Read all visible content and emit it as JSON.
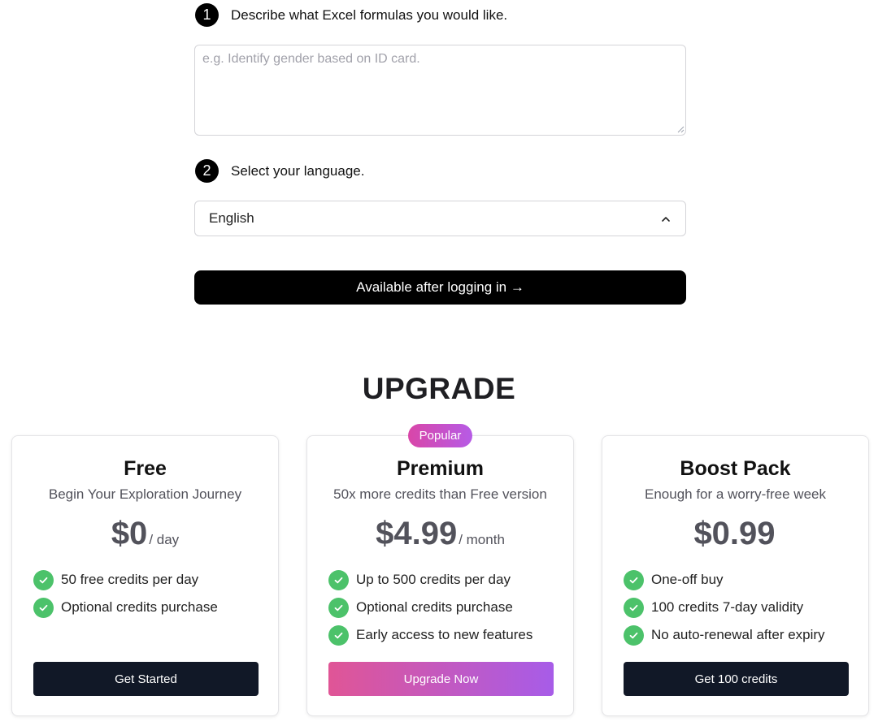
{
  "steps": [
    {
      "number": "1",
      "text": "Describe what Excel formulas you would like."
    },
    {
      "number": "2",
      "text": "Select your language."
    }
  ],
  "formula_input": {
    "placeholder": "e.g. Identify gender based on ID card.",
    "value": ""
  },
  "language_select": {
    "value": "English",
    "icon": "chevron-up-icon"
  },
  "login_button": {
    "label": "Available after logging in →"
  },
  "upgrade": {
    "title": "UPGRADE"
  },
  "plans": [
    {
      "name": "Free",
      "subtitle": "Begin Your Exploration Journey",
      "price": "$0",
      "period": "/ day",
      "features": [
        "50 free credits per day",
        "Optional credits purchase"
      ],
      "button": "Get Started"
    },
    {
      "name": "Premium",
      "badge": "Popular",
      "subtitle": "50x more credits than Free version",
      "price": "$4.99",
      "period": "/ month",
      "features": [
        "Up to 500 credits per day",
        "Optional credits purchase",
        "Early access to new features"
      ],
      "button": "Upgrade Now"
    },
    {
      "name": "Boost Pack",
      "subtitle": "Enough for a worry-free week",
      "price": "$0.99",
      "period": "",
      "features": [
        "One-off buy",
        "100 credits 7-day validity",
        "No auto-renewal after expiry"
      ],
      "button": "Get 100 credits"
    }
  ],
  "colors": {
    "primary_button": "#000000",
    "card_button": "#111827",
    "check": "#4cc26a",
    "gradient_start": "#e05596",
    "gradient_end": "#a75ce8"
  }
}
